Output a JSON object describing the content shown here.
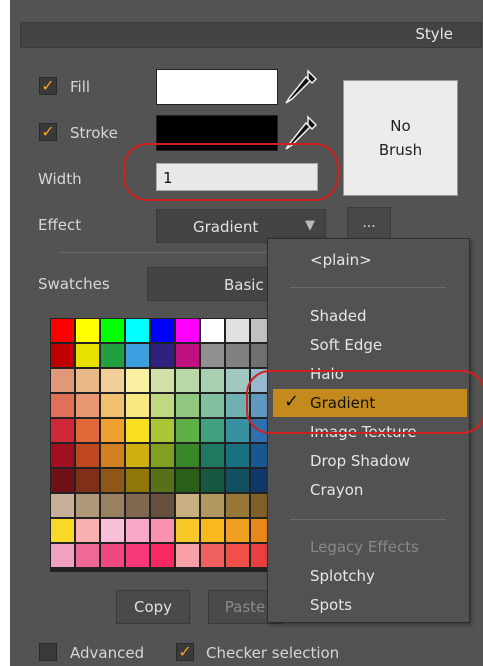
{
  "panel": {
    "title": "Style"
  },
  "fill": {
    "label": "Fill",
    "checked": true,
    "color": "#ffffff"
  },
  "stroke": {
    "label": "Stroke",
    "checked": true,
    "color": "#000000"
  },
  "brush_preview": {
    "line1": "No",
    "line2": "Brush"
  },
  "width": {
    "label": "Width",
    "value": "1"
  },
  "effect": {
    "label": "Effect",
    "value": "Gradient",
    "more_label": "..."
  },
  "swatches": {
    "label": "Swatches",
    "value": "Basic C"
  },
  "buttons": {
    "copy": "Copy",
    "paste": "Paste"
  },
  "options": {
    "advanced": {
      "label": "Advanced",
      "checked": false
    },
    "checker": {
      "label": "Checker selection",
      "checked": true
    }
  },
  "menu": {
    "items": [
      {
        "label": "<plain>",
        "enabled": true
      },
      {
        "label": "Shaded",
        "enabled": true
      },
      {
        "label": "Soft Edge",
        "enabled": true
      },
      {
        "label": "Halo",
        "enabled": true
      },
      {
        "label": "Gradient",
        "enabled": true,
        "selected": true
      },
      {
        "label": "Image Texture",
        "enabled": true
      },
      {
        "label": "Drop Shadow",
        "enabled": true
      },
      {
        "label": "Crayon",
        "enabled": true
      },
      {
        "label": "Legacy Effects",
        "enabled": false
      },
      {
        "label": "Splotchy",
        "enabled": true
      },
      {
        "label": "Spots",
        "enabled": true
      }
    ]
  },
  "colors": {
    "panel_bg": "#535353",
    "accent": "#c48a1e",
    "highlight_circle": "#d02020"
  },
  "swatch_grid": [
    [
      "#ff0000",
      "#ffff00",
      "#00ff00",
      "#00ffff",
      "#0000ff",
      "#ff00ff",
      "#ffffff",
      "#e0e0e0",
      "#c0c0c0"
    ],
    [
      "#c00000",
      "#e8e000",
      "#20a040",
      "#3ca0e0",
      "#302080",
      "#c01080",
      "#909090",
      "#808080",
      "#707070"
    ],
    [
      "#e09878",
      "#e8b888",
      "#f0d098",
      "#f8f0a0",
      "#d0e0a8",
      "#b8d8a8",
      "#a8d0b0",
      "#a0c8c0",
      "#98b8d0"
    ],
    [
      "#e07058",
      "#e89870",
      "#f0c070",
      "#f8e880",
      "#c0d880",
      "#90c880",
      "#80c0a0",
      "#70b0b0",
      "#6098c0"
    ],
    [
      "#d02838",
      "#e06838",
      "#f0a030",
      "#f8e020",
      "#a8c838",
      "#60b048",
      "#40a080",
      "#3890a0",
      "#3070b0"
    ],
    [
      "#a01020",
      "#c04820",
      "#d08020",
      "#d0b010",
      "#80a020",
      "#388828",
      "#207860",
      "#187080",
      "#185890"
    ],
    [
      "#701018",
      "#803018",
      "#905818",
      "#907808",
      "#587018",
      "#286018",
      "#185840",
      "#105060",
      "#103868"
    ],
    [
      "#c8b098",
      "#b09878",
      "#988060",
      "#806850",
      "#685040",
      "#c8b080",
      "#b09860",
      "#987838",
      "#806028"
    ],
    [
      "#f8d828",
      "#f8b0b0",
      "#f8c0d8",
      "#f8a8c8",
      "#f890b0",
      "#f8c828",
      "#f8b820",
      "#f0a020",
      "#e88818"
    ],
    [
      "#f0a0c0",
      "#f06898",
      "#f04880",
      "#f83878",
      "#f82860",
      "#f8a0a8",
      "#f06060",
      "#f05048",
      "#e84040"
    ]
  ]
}
